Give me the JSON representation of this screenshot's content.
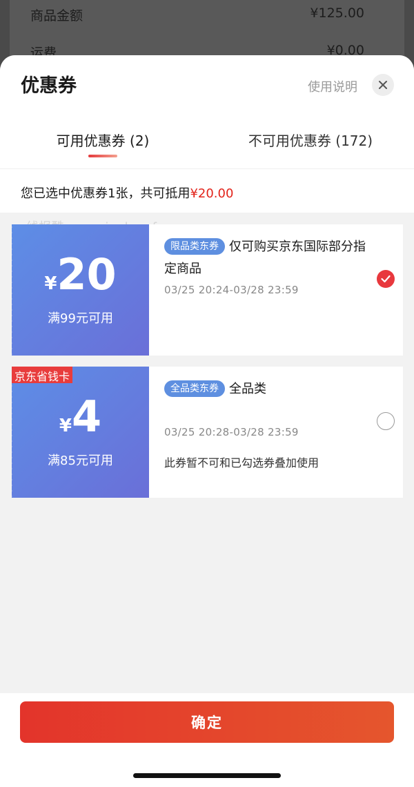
{
  "background": {
    "rows": [
      {
        "label": "商品金额",
        "value": "¥125.00"
      },
      {
        "label": "运费",
        "value": "¥0.00"
      }
    ]
  },
  "sheet": {
    "title": "优惠券",
    "help_link": "使用说明",
    "close_icon": "close-icon"
  },
  "tabs": [
    {
      "label": "可用优惠券 (2)",
      "active": true
    },
    {
      "label": "不可用优惠券 (172)",
      "active": false
    }
  ],
  "summary": {
    "text": "您已选中优惠券1张，共可抵用",
    "amount": "¥20.00"
  },
  "watermark": "线报酷 new.xianbao.fun",
  "coupons": [
    {
      "currency": "¥",
      "amount": "20",
      "condition": "满99元可用",
      "category": "限品类东券",
      "description": "仅可购买京东国际部分指定商品",
      "validity": "03/25 20:24-03/28 23:59",
      "selected": true
    },
    {
      "tag": "京东省钱卡",
      "currency": "¥",
      "amount": "4",
      "condition": "满85元可用",
      "category": "全品类东券",
      "description": "全品类",
      "validity": "03/25 20:28-03/28 23:59",
      "note": "此券暂不可和已勾选券叠加使用",
      "selected": false
    }
  ],
  "footer": {
    "confirm_label": "确定"
  },
  "colors": {
    "accent_red": "#e4393c",
    "coupon_blue": "#5d8ee6"
  }
}
